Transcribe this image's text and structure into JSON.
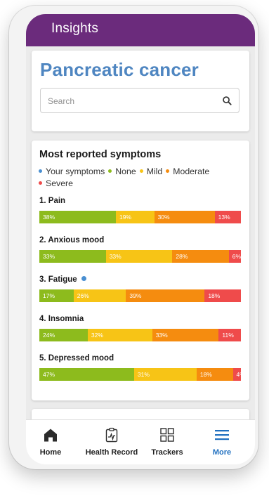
{
  "header": {
    "title": "Insights"
  },
  "page": {
    "title": "Pancreatic cancer",
    "search": {
      "placeholder": "Search"
    }
  },
  "symptoms_card": {
    "title": "Most reported symptoms",
    "legend": [
      {
        "label": "Your symptoms",
        "color": "#4a8fd1"
      },
      {
        "label": "None",
        "color": "#8dbb1d"
      },
      {
        "label": "Mild",
        "color": "#f7c416"
      },
      {
        "label": "Moderate",
        "color": "#f58c0f"
      },
      {
        "label": "Severe",
        "color": "#ef4b4b"
      }
    ],
    "symptoms": [
      {
        "label": "1. Pain",
        "yours": false,
        "values": [
          38,
          19,
          30,
          13
        ],
        "labels": [
          "38%",
          "19%",
          "30%",
          "13%"
        ]
      },
      {
        "label": "2. Anxious mood",
        "yours": false,
        "values": [
          33,
          33,
          28,
          6
        ],
        "labels": [
          "33%",
          "33%",
          "28%",
          "6%"
        ]
      },
      {
        "label": "3. Fatigue",
        "yours": true,
        "values": [
          17,
          26,
          39,
          18
        ],
        "labels": [
          "17%",
          "26%",
          "39%",
          "18%"
        ]
      },
      {
        "label": "4. Insomnia",
        "yours": false,
        "values": [
          24,
          32,
          33,
          11
        ],
        "labels": [
          "24%",
          "32%",
          "33%",
          "11%"
        ]
      },
      {
        "label": "5. Depressed mood",
        "yours": false,
        "values": [
          47,
          31,
          18,
          4
        ],
        "labels": [
          "47%",
          "31%",
          "18%",
          "4%"
        ]
      }
    ]
  },
  "chart_data": {
    "type": "bar",
    "stacked": true,
    "orientation": "horizontal",
    "categories": [
      "1. Pain",
      "2. Anxious mood",
      "3. Fatigue",
      "4. Insomnia",
      "5. Depressed mood"
    ],
    "series": [
      {
        "name": "None",
        "values": [
          38,
          33,
          17,
          24,
          47
        ]
      },
      {
        "name": "Mild",
        "values": [
          19,
          33,
          26,
          32,
          31
        ]
      },
      {
        "name": "Moderate",
        "values": [
          30,
          28,
          39,
          33,
          18
        ]
      },
      {
        "name": "Severe",
        "values": [
          13,
          6,
          18,
          11,
          4
        ]
      }
    ],
    "title": "Most reported symptoms",
    "xlabel": "",
    "ylabel": "",
    "xlim": [
      0,
      100
    ]
  },
  "nav": {
    "items": [
      {
        "label": "Home",
        "icon": "home-icon",
        "active": false
      },
      {
        "label": "Health Record",
        "icon": "health-record-icon",
        "active": false
      },
      {
        "label": "Trackers",
        "icon": "trackers-grid-icon",
        "active": false
      },
      {
        "label": "More",
        "icon": "menu-icon",
        "active": true
      }
    ]
  },
  "colors": {
    "header": "#6b2b7c",
    "title": "#4f86c1",
    "active_nav": "#1f6fbf"
  }
}
